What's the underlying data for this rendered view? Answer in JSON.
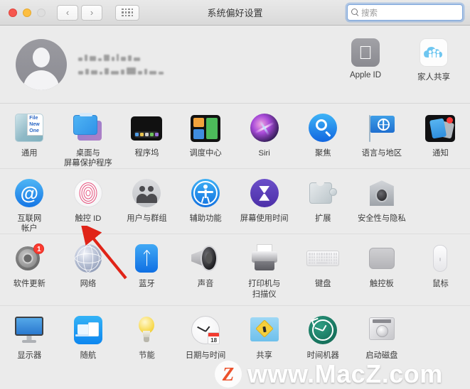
{
  "window": {
    "title": "系统偏好设置",
    "traffic_lights": [
      "close",
      "minimize",
      "zoom-disabled"
    ],
    "nav": {
      "back": "‹",
      "forward": "›",
      "grid": "grid-icon"
    }
  },
  "search": {
    "placeholder": "搜索",
    "value": "",
    "icon": "search-icon"
  },
  "account": {
    "avatar": "user-avatar",
    "name_redacted": true,
    "items": [
      {
        "label": "Apple ID",
        "icon": "apple-logo-icon"
      },
      {
        "label": "家人共享",
        "icon": "family-sharing-icon"
      }
    ]
  },
  "grid": {
    "rows": [
      {
        "id": "row-1",
        "items": [
          {
            "label": "通用",
            "icon": "general-icon"
          },
          {
            "label": "桌面与\n屏幕保护程序",
            "icon": "desktop-screensaver-icon"
          },
          {
            "label": "程序坞",
            "icon": "dock-icon"
          },
          {
            "label": "调度中心",
            "icon": "mission-control-icon"
          },
          {
            "label": "Siri",
            "icon": "siri-icon"
          },
          {
            "label": "聚焦",
            "icon": "spotlight-icon"
          },
          {
            "label": "语言与地区",
            "icon": "language-region-icon"
          },
          {
            "label": "通知",
            "icon": "notifications-icon"
          }
        ]
      },
      {
        "id": "row-2",
        "items": [
          {
            "label": "互联网\n帐户",
            "icon": "internet-accounts-icon"
          },
          {
            "label": "触控 ID",
            "icon": "touch-id-icon",
            "highlighted": true
          },
          {
            "label": "用户与群组",
            "icon": "users-groups-icon"
          },
          {
            "label": "辅助功能",
            "icon": "accessibility-icon"
          },
          {
            "label": "屏幕使用时间",
            "icon": "screen-time-icon"
          },
          {
            "label": "扩展",
            "icon": "extensions-icon"
          },
          {
            "label": "安全性与隐私",
            "icon": "security-privacy-icon"
          }
        ]
      },
      {
        "id": "row-3",
        "items": [
          {
            "label": "软件更新",
            "icon": "software-update-icon",
            "badge": "1"
          },
          {
            "label": "网络",
            "icon": "network-icon"
          },
          {
            "label": "蓝牙",
            "icon": "bluetooth-icon"
          },
          {
            "label": "声音",
            "icon": "sound-icon"
          },
          {
            "label": "打印机与\n扫描仪",
            "icon": "printers-scanners-icon"
          },
          {
            "label": "键盘",
            "icon": "keyboard-icon"
          },
          {
            "label": "触控板",
            "icon": "trackpad-icon"
          },
          {
            "label": "鼠标",
            "icon": "mouse-icon"
          }
        ]
      },
      {
        "id": "row-4",
        "items": [
          {
            "label": "显示器",
            "icon": "displays-icon"
          },
          {
            "label": "随航",
            "icon": "sidecar-icon"
          },
          {
            "label": "节能",
            "icon": "energy-saver-icon"
          },
          {
            "label": "日期与时间",
            "icon": "date-time-icon",
            "calendar_day": "18"
          },
          {
            "label": "共享",
            "icon": "sharing-icon"
          },
          {
            "label": "时间机器",
            "icon": "time-machine-icon"
          },
          {
            "label": "启动磁盘",
            "icon": "startup-disk-icon"
          }
        ]
      }
    ]
  },
  "annotations": {
    "arrow": {
      "name": "red-arrow-pointing-to-touch-id",
      "color": "#e02418"
    }
  },
  "watermark": {
    "logo_letter": "Z",
    "text": "www.MacZ.com",
    "logo_color": "#ec512b"
  },
  "colors": {
    "background": "#ebebeb",
    "titlebar": "#e0e0e0",
    "accent_blue": "#1576e5",
    "badge_red": "#fb3b30",
    "arrow_red": "#e02418"
  }
}
